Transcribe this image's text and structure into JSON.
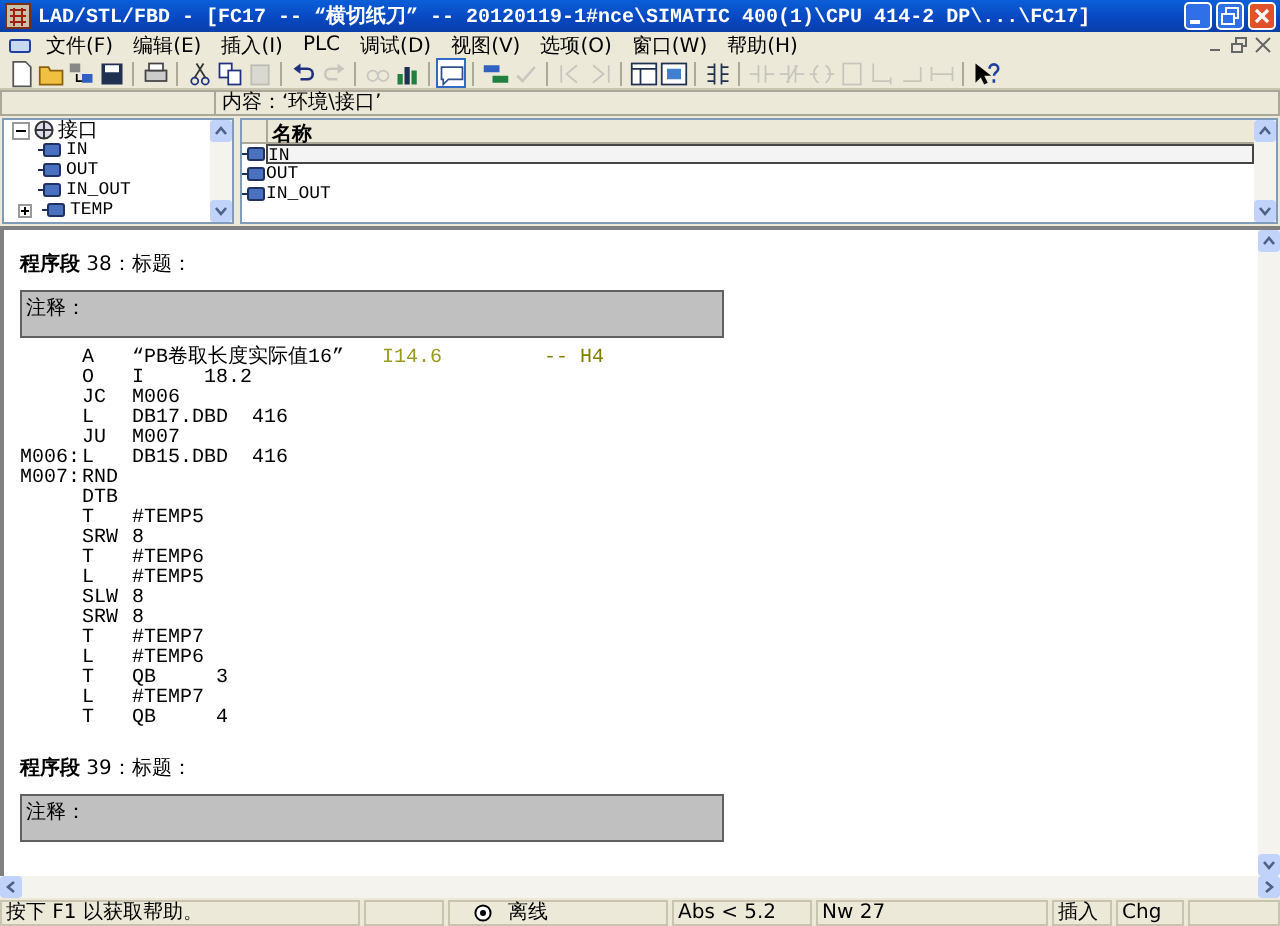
{
  "window": {
    "title": "LAD/STL/FBD  - [FC17 -- “横切纸刀” -- 20120119-1#nce\\SIMATIC 400(1)\\CPU 414-2 DP\\...\\FC17]"
  },
  "menu": [
    "文件(F)",
    "编辑(E)",
    "插入(I)",
    "PLC",
    "调试(D)",
    "视图(V)",
    "选项(O)",
    "窗口(W)",
    "帮助(H)"
  ],
  "toolbar": [
    {
      "kind": "new",
      "disabled": false,
      "pressed": false
    },
    {
      "kind": "open",
      "disabled": false,
      "pressed": false
    },
    {
      "kind": "download",
      "disabled": false,
      "pressed": false
    },
    {
      "kind": "save",
      "disabled": false,
      "pressed": false
    },
    {
      "kind": "sep"
    },
    {
      "kind": "print",
      "disabled": false,
      "pressed": false
    },
    {
      "kind": "sep"
    },
    {
      "kind": "cut",
      "disabled": false,
      "pressed": false
    },
    {
      "kind": "copy",
      "disabled": false,
      "pressed": false
    },
    {
      "kind": "paste",
      "disabled": true,
      "pressed": false
    },
    {
      "kind": "sep"
    },
    {
      "kind": "undo",
      "disabled": false,
      "pressed": false
    },
    {
      "kind": "redo",
      "disabled": true,
      "pressed": false
    },
    {
      "kind": "sep"
    },
    {
      "kind": "monitor",
      "disabled": true,
      "pressed": false
    },
    {
      "kind": "chart",
      "disabled": false,
      "pressed": false
    },
    {
      "kind": "sep"
    },
    {
      "kind": "note",
      "disabled": false,
      "pressed": true
    },
    {
      "kind": "sep"
    },
    {
      "kind": "network",
      "disabled": false,
      "pressed": false
    },
    {
      "kind": "check",
      "disabled": true,
      "pressed": false
    },
    {
      "kind": "sep"
    },
    {
      "kind": "first",
      "disabled": true,
      "pressed": false
    },
    {
      "kind": "last",
      "disabled": true,
      "pressed": false
    },
    {
      "kind": "sep"
    },
    {
      "kind": "layout",
      "disabled": false,
      "pressed": false
    },
    {
      "kind": "image",
      "disabled": false,
      "pressed": false
    },
    {
      "kind": "sep"
    },
    {
      "kind": "mnemonic",
      "disabled": false,
      "pressed": false
    },
    {
      "kind": "sep"
    },
    {
      "kind": "contact",
      "disabled": true,
      "pressed": false
    },
    {
      "kind": "contact-nc",
      "disabled": true,
      "pressed": false
    },
    {
      "kind": "coil",
      "disabled": true,
      "pressed": false
    },
    {
      "kind": "box",
      "disabled": true,
      "pressed": false
    },
    {
      "kind": "branch-down",
      "disabled": true,
      "pressed": false
    },
    {
      "kind": "branch-up",
      "disabled": true,
      "pressed": false
    },
    {
      "kind": "connector",
      "disabled": true,
      "pressed": false
    },
    {
      "kind": "sep"
    },
    {
      "kind": "help",
      "disabled": false,
      "pressed": false
    }
  ],
  "content_bar": {
    "text": "内容：‘环境\\接口’"
  },
  "tree": {
    "label": "接口",
    "expanded": true,
    "children": [
      {
        "label": "IN",
        "expandable": false
      },
      {
        "label": "OUT",
        "expandable": false
      },
      {
        "label": "IN_OUT",
        "expandable": false
      },
      {
        "label": "TEMP",
        "expandable": true
      }
    ]
  },
  "table": {
    "columns": [
      "名称"
    ],
    "rows": [
      {
        "name": "IN",
        "selected": true
      },
      {
        "name": "OUT",
        "selected": false
      },
      {
        "name": "IN_OUT",
        "selected": false
      }
    ]
  },
  "networks": [
    {
      "heading": "**程序段** 38：标题：",
      "comment": "注释：",
      "lines": [
        {
          "op": "A",
          "operand": "“PB卷取长度实际值16”",
          "address": "I14.6",
          "comment": "-- H4"
        },
        {
          "op": "O",
          "operand": "I     18.2"
        },
        {
          "op": "JC",
          "operand": "M006"
        },
        {
          "op": "L",
          "operand": "DB17.DBD  416"
        },
        {
          "op": "JU",
          "operand": "M007"
        },
        {
          "label": "M006:",
          "op": "L",
          "operand": "DB15.DBD  416"
        },
        {
          "label": "M007:",
          "op": "RND"
        },
        {
          "op": "DTB"
        },
        {
          "op": "T",
          "operand": "#TEMP5"
        },
        {
          "op": "SRW",
          "operand": "8"
        },
        {
          "op": "T",
          "operand": "#TEMP6"
        },
        {
          "op": "L",
          "operand": "#TEMP5"
        },
        {
          "op": "SLW",
          "operand": "8"
        },
        {
          "op": "SRW",
          "operand": "8"
        },
        {
          "op": "T",
          "operand": "#TEMP7"
        },
        {
          "op": "L",
          "operand": "#TEMP6"
        },
        {
          "op": "T",
          "operand": "QB     3"
        },
        {
          "op": "L",
          "operand": "#TEMP7"
        },
        {
          "op": "T",
          "operand": "QB     4"
        }
      ]
    },
    {
      "heading": "**程序段** 39：标题：",
      "comment": "注释："
    }
  ],
  "status_bar": {
    "help": "按下 F1 以获取帮助。",
    "mode": "离线",
    "position": "Abs < 5.2",
    "network": "Nw 27",
    "insert": "插入",
    "change": "Chg"
  }
}
